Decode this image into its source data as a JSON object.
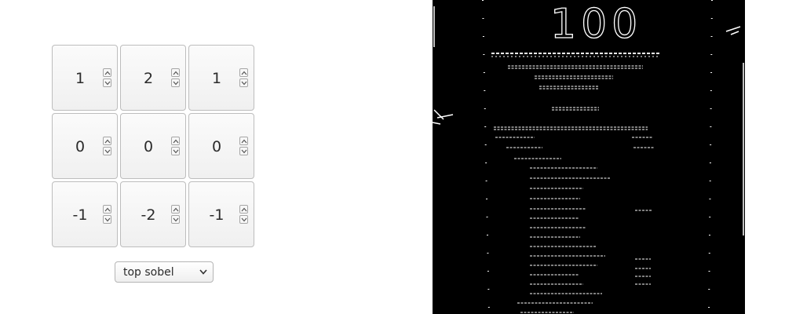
{
  "kernel": {
    "rows": [
      [
        "1",
        "2",
        "1"
      ],
      [
        "0",
        "0",
        "0"
      ],
      [
        "-1",
        "-2",
        "-1"
      ]
    ]
  },
  "preset_select": {
    "selected": "top sobel",
    "icon": "chevron-down-icon"
  },
  "output_image": {
    "description_hidden": "",
    "receipt_big_number": "100",
    "colors": {
      "background": "#000000",
      "edges": "#ffffff"
    }
  },
  "spinner_icons": {
    "up": "chevron-up-icon",
    "down": "chevron-down-icon"
  }
}
